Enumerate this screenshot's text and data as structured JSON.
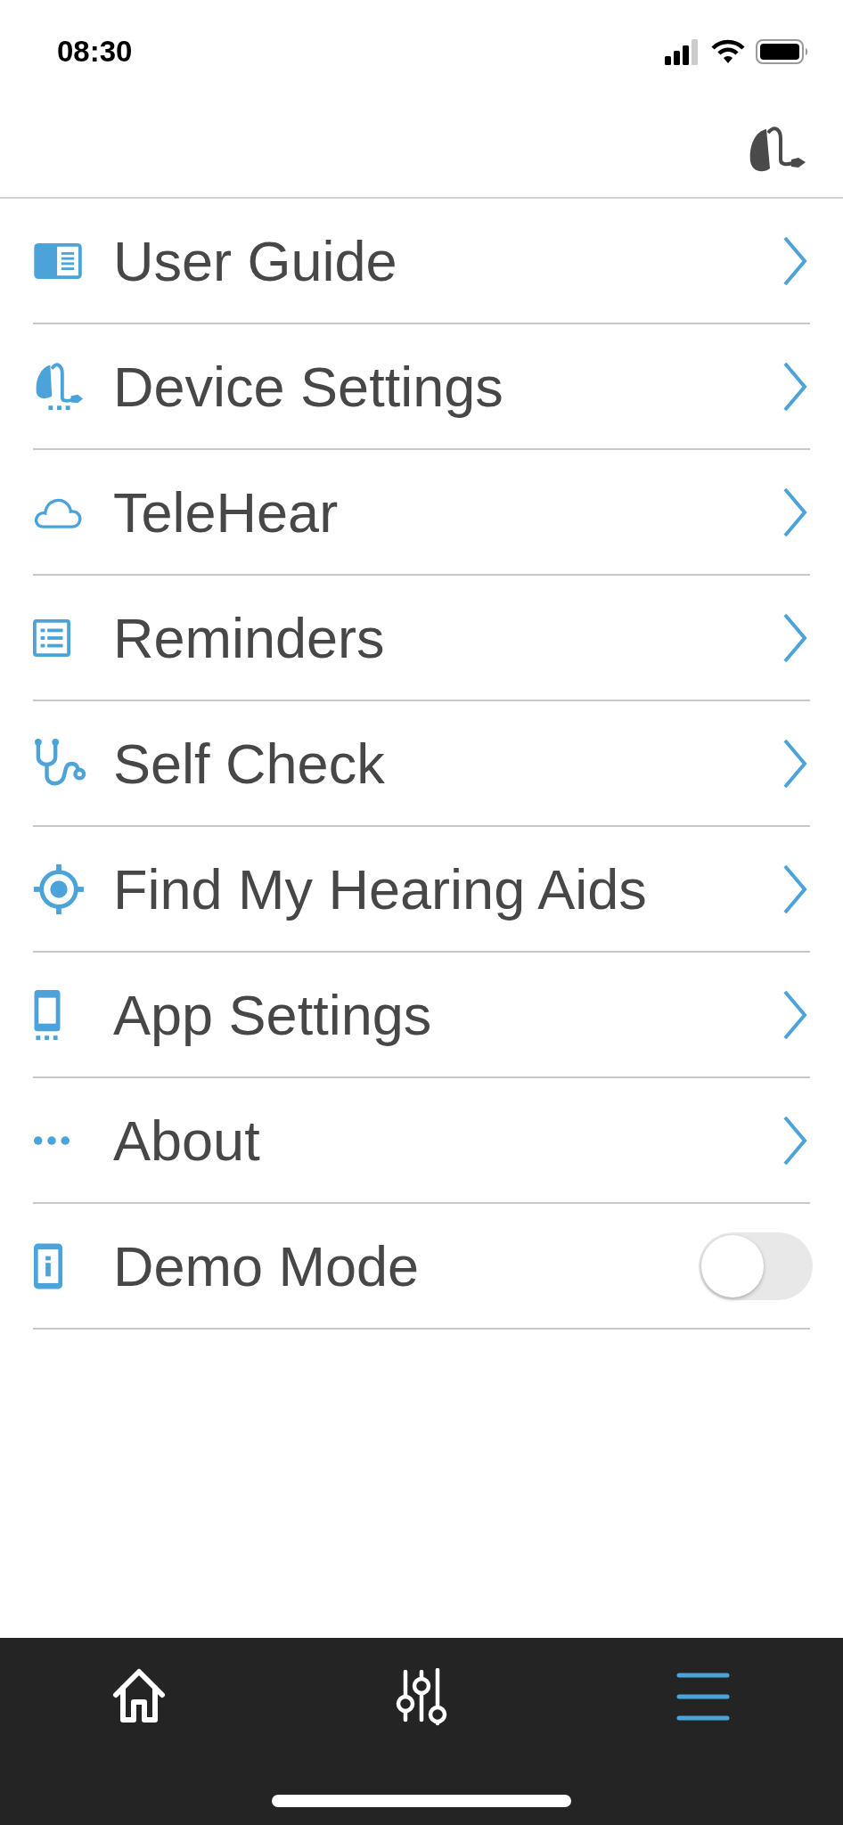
{
  "status_bar": {
    "time": "08:30"
  },
  "menu": [
    {
      "kind": "link",
      "label": "User Guide"
    },
    {
      "kind": "link",
      "label": "Device Settings"
    },
    {
      "kind": "link",
      "label": "TeleHear"
    },
    {
      "kind": "link",
      "label": "Reminders"
    },
    {
      "kind": "link",
      "label": "Self Check"
    },
    {
      "kind": "link",
      "label": "Find My Hearing Aids"
    },
    {
      "kind": "link",
      "label": "App Settings"
    },
    {
      "kind": "link",
      "label": "About"
    },
    {
      "kind": "toggle",
      "label": "Demo Mode",
      "on": false
    }
  ],
  "tab_bar": [
    {
      "selected": false
    },
    {
      "selected": false
    },
    {
      "selected": true
    }
  ]
}
